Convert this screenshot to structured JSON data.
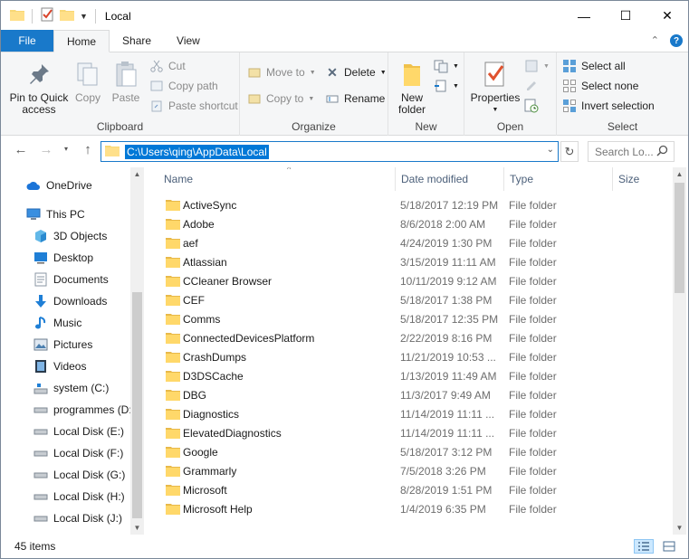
{
  "window": {
    "title": "Local"
  },
  "titlebar": {
    "minimize": "—",
    "maximize": "☐",
    "close": "✕"
  },
  "tabs": [
    {
      "label": "File"
    },
    {
      "label": "Home"
    },
    {
      "label": "Share"
    },
    {
      "label": "View"
    }
  ],
  "ribbon": {
    "clipboard": {
      "label": "Clipboard",
      "pin_label": "Pin to Quick access",
      "copy_label": "Copy",
      "paste_label": "Paste",
      "cut_label": "Cut",
      "copy_path_label": "Copy path",
      "paste_shortcut_label": "Paste shortcut"
    },
    "organize": {
      "label": "Organize",
      "move_to_label": "Move to",
      "copy_to_label": "Copy to",
      "delete_label": "Delete",
      "rename_label": "Rename"
    },
    "new": {
      "label": "New",
      "new_folder_label": "New folder"
    },
    "open": {
      "label": "Open",
      "properties_label": "Properties"
    },
    "select": {
      "label": "Select",
      "select_all_label": "Select all",
      "select_none_label": "Select none",
      "invert_selection_label": "Invert selection"
    }
  },
  "address": {
    "path": "C:\\Users\\qing\\AppData\\Local",
    "search_placeholder": "Search Lo..."
  },
  "nav_pane": {
    "items": [
      {
        "label": "OneDrive",
        "icon": "cloud-icon"
      },
      {
        "label": "This PC",
        "icon": "computer-icon"
      },
      {
        "label": "3D Objects",
        "icon": "cube-icon"
      },
      {
        "label": "Desktop",
        "icon": "desktop-icon"
      },
      {
        "label": "Documents",
        "icon": "document-icon"
      },
      {
        "label": "Downloads",
        "icon": "download-icon"
      },
      {
        "label": "Music",
        "icon": "music-icon"
      },
      {
        "label": "Pictures",
        "icon": "picture-icon"
      },
      {
        "label": "Videos",
        "icon": "video-icon"
      },
      {
        "label": "system (C:)",
        "icon": "system-drive-icon"
      },
      {
        "label": "programmes (D:",
        "icon": "drive-icon"
      },
      {
        "label": "Local Disk (E:)",
        "icon": "drive-icon"
      },
      {
        "label": "Local Disk (F:)",
        "icon": "drive-icon"
      },
      {
        "label": "Local Disk (G:)",
        "icon": "drive-icon"
      },
      {
        "label": "Local Disk (H:)",
        "icon": "drive-icon"
      },
      {
        "label": "Local Disk (J:)",
        "icon": "drive-icon"
      }
    ]
  },
  "columns": {
    "name": "Name",
    "date": "Date modified",
    "type": "Type",
    "size": "Size"
  },
  "files": [
    {
      "name": "ActiveSync",
      "date": "5/18/2017 12:19 PM",
      "type": "File folder"
    },
    {
      "name": "Adobe",
      "date": "8/6/2018 2:00 AM",
      "type": "File folder"
    },
    {
      "name": "aef",
      "date": "4/24/2019 1:30 PM",
      "type": "File folder"
    },
    {
      "name": "Atlassian",
      "date": "3/15/2019 11:11 AM",
      "type": "File folder"
    },
    {
      "name": "CCleaner Browser",
      "date": "10/11/2019 9:12 AM",
      "type": "File folder"
    },
    {
      "name": "CEF",
      "date": "5/18/2017 1:38 PM",
      "type": "File folder"
    },
    {
      "name": "Comms",
      "date": "5/18/2017 12:35 PM",
      "type": "File folder"
    },
    {
      "name": "ConnectedDevicesPlatform",
      "date": "2/22/2019 8:16 PM",
      "type": "File folder"
    },
    {
      "name": "CrashDumps",
      "date": "11/21/2019 10:53 ...",
      "type": "File folder"
    },
    {
      "name": "D3DSCache",
      "date": "1/13/2019 11:49 AM",
      "type": "File folder"
    },
    {
      "name": "DBG",
      "date": "11/3/2017 9:49 AM",
      "type": "File folder"
    },
    {
      "name": "Diagnostics",
      "date": "11/14/2019 11:11 ...",
      "type": "File folder"
    },
    {
      "name": "ElevatedDiagnostics",
      "date": "11/14/2019 11:11 ...",
      "type": "File folder"
    },
    {
      "name": "Google",
      "date": "5/18/2017 3:12 PM",
      "type": "File folder"
    },
    {
      "name": "Grammarly",
      "date": "7/5/2018 3:26 PM",
      "type": "File folder"
    },
    {
      "name": "Microsoft",
      "date": "8/28/2019 1:51 PM",
      "type": "File folder"
    },
    {
      "name": "Microsoft Help",
      "date": "1/4/2019 6:35 PM",
      "type": "File folder"
    }
  ],
  "status": {
    "count": "45 items"
  }
}
